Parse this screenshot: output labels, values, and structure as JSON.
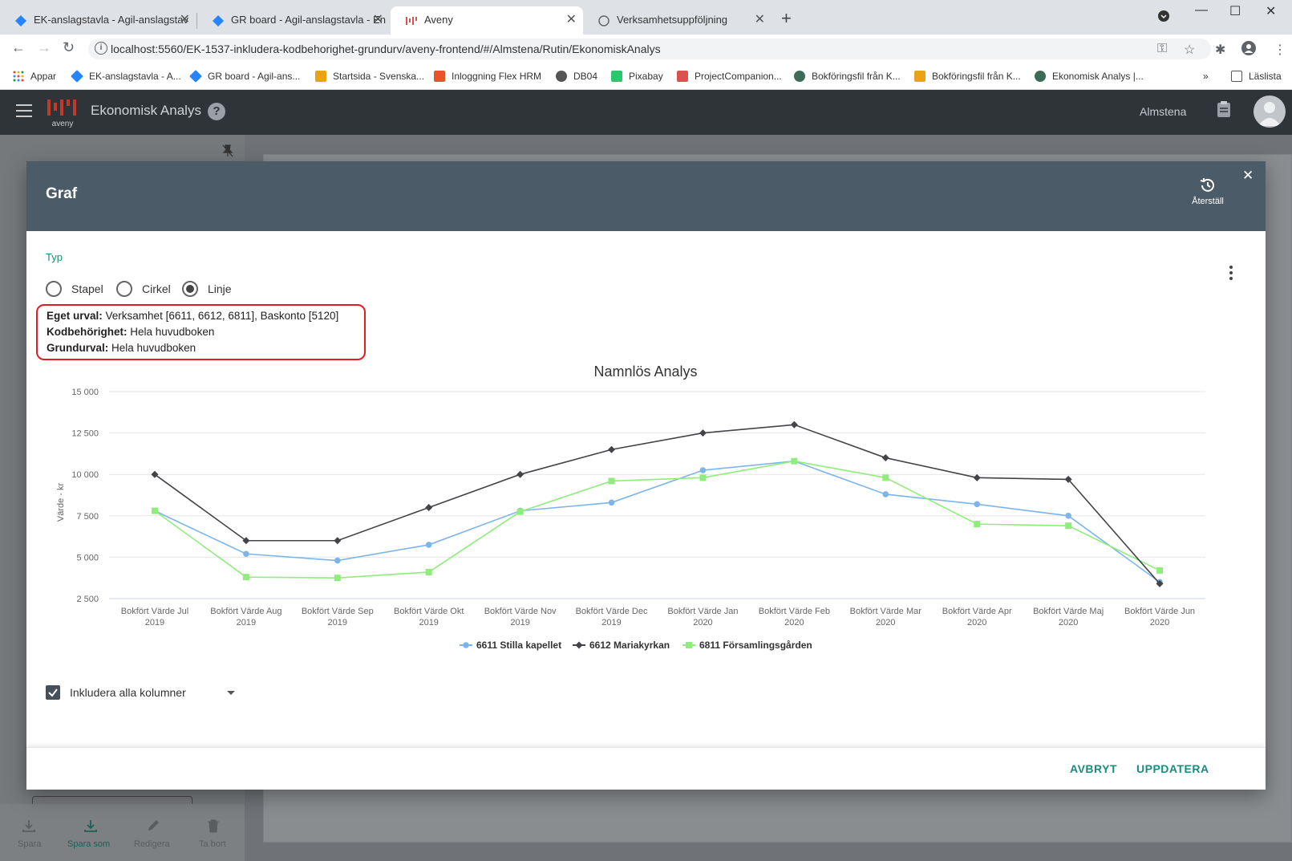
{
  "browser": {
    "tabs": [
      {
        "label": "EK-anslagstavla - Agil-anslagstav",
        "active": false
      },
      {
        "label": "GR board - Agil-anslagstavla - En",
        "active": false
      },
      {
        "label": "Aveny",
        "active": true
      },
      {
        "label": "Verksamhetsuppföljning",
        "active": false
      }
    ],
    "url": "localhost:5560/EK-1537-inkludera-kodbehorighet-grundurv/aveny-frontend/#/Almstena/Rutin/EkonomiskAnalys",
    "bookmarks": [
      {
        "label": "Appar",
        "color": "#e8453c"
      },
      {
        "label": "EK-anslagstavla - A...",
        "color": "#2684ff"
      },
      {
        "label": "GR board - Agil-ans...",
        "color": "#2684ff"
      },
      {
        "label": "Startsida - Svenska...",
        "color": "#e8a317"
      },
      {
        "label": "Inloggning Flex HRM",
        "color": "#e8532b"
      },
      {
        "label": "DB04",
        "color": "#555555"
      },
      {
        "label": "Pixabay",
        "color": "#2ec66d"
      },
      {
        "label": "ProjectCompanion...",
        "color": "#d9534f"
      },
      {
        "label": "Bokföringsfil från K...",
        "color": "#3d6b57"
      },
      {
        "label": "Bokföringsfil från K...",
        "color": "#e8a317"
      },
      {
        "label": "Ekonomisk Analys |...",
        "color": "#3d6b57"
      }
    ],
    "reading_list": "Läslista"
  },
  "app": {
    "logo_text": "aveny",
    "title": "Ekonomisk Analys",
    "help": "?",
    "org": "Almstena"
  },
  "background_footer": {
    "items": [
      "Spara",
      "Spara som",
      "Redigera",
      "Ta bort"
    ]
  },
  "dialog": {
    "title": "Graf",
    "reset_label": "Återställ",
    "type_label": "Typ",
    "types": [
      {
        "label": "Stapel",
        "selected": false
      },
      {
        "label": "Cirkel",
        "selected": false
      },
      {
        "label": "Linje",
        "selected": true
      }
    ],
    "selection": {
      "eget_urval_key": "Eget urval:",
      "eget_urval_value": " Verksamhet [6611, 6612, 6811], Baskonto [5120]",
      "kodbehorighet_key": "Kodbehörighet:",
      "kodbehorighet_value": " Hela huvudboken",
      "grundurval_key": "Grundurval:",
      "grundurval_value": " Hela huvudboken"
    },
    "include_all_columns_label": "Inkludera alla kolumner",
    "include_all_columns_checked": true,
    "cancel_label": "AVBRYT",
    "update_label": "UPPDATERA"
  },
  "chart_data": {
    "type": "line",
    "title": "Namnlös Analys",
    "ylabel": "Värde - kr",
    "xlabel": "",
    "ylim": [
      2500,
      15000
    ],
    "yticks": [
      2500,
      5000,
      7500,
      10000,
      12500,
      15000
    ],
    "ytick_labels": [
      "2 500",
      "5 000",
      "7 500",
      "10 000",
      "12 500",
      "15 000"
    ],
    "grid": true,
    "legend_position": "bottom",
    "categories": [
      [
        "Bokfört Värde Jul",
        "2019"
      ],
      [
        "Bokfört Värde Aug",
        "2019"
      ],
      [
        "Bokfört Värde Sep",
        "2019"
      ],
      [
        "Bokfört Värde Okt",
        "2019"
      ],
      [
        "Bokfört Värde Nov",
        "2019"
      ],
      [
        "Bokfört Värde Dec",
        "2019"
      ],
      [
        "Bokfört Värde Jan",
        "2020"
      ],
      [
        "Bokfört Värde Feb",
        "2020"
      ],
      [
        "Bokfört Värde Mar",
        "2020"
      ],
      [
        "Bokfört Värde Apr",
        "2020"
      ],
      [
        "Bokfört Värde Maj",
        "2020"
      ],
      [
        "Bokfört Värde Jun",
        "2020"
      ]
    ],
    "series": [
      {
        "name": "6611 Stilla kapellet",
        "color": "#7cb5ec",
        "marker": "circle",
        "values": [
          7800,
          5200,
          4800,
          5750,
          7800,
          8300,
          10250,
          10800,
          8800,
          8200,
          7500,
          3500
        ]
      },
      {
        "name": "6612 Mariakyrkan",
        "color": "#434348",
        "marker": "diamond",
        "values": [
          10000,
          6000,
          6000,
          8000,
          10000,
          11500,
          12500,
          13000,
          11000,
          9800,
          9700,
          3400
        ]
      },
      {
        "name": "6811 Församlingsgården",
        "color": "#90ed7d",
        "marker": "square",
        "values": [
          7800,
          3800,
          3750,
          4100,
          7750,
          9600,
          9800,
          10800,
          9800,
          7000,
          6900,
          4200
        ]
      }
    ]
  }
}
